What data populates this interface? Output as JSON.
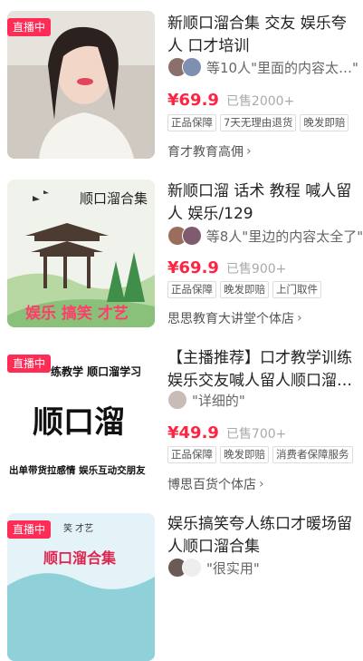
{
  "products": [
    {
      "badge": "直播中",
      "title": "新顺口溜合集  交友  娱乐夸人  口才培训",
      "buyers": "等10人\"里面的内容太…\"",
      "price": "¥69.9",
      "sold": "已售2000+",
      "tags": [
        "正品保障",
        "7天无理由退货",
        "晚发即赔"
      ],
      "shop": "育才教育高佣"
    },
    {
      "badge": "",
      "thumb_text": {
        "title": "顺口溜合集",
        "bottom": "娱乐  搞笑  才艺"
      },
      "title": "新顺口溜  话术  教程  喊人留人  娱乐/129",
      "buyers": "等8人\"里边的内容太全了\"",
      "price": "¥69.9",
      "sold": "已售900+",
      "tags": [
        "正品保障",
        "晚发即赔",
        "上门取件"
      ],
      "shop": "思思教育大讲堂个体店"
    },
    {
      "badge": "直播中",
      "thumb_text": {
        "top": "练教学  顺口溜学习",
        "main": "顺口溜",
        "bottom": "出单带货拉感情  娱乐互动交朋友"
      },
      "title": "【主播推荐】口才教学训练娱乐交友喊人留人顺口溜…",
      "buyers": "\"详细的\"",
      "price": "¥49.9",
      "sold": "已售700+",
      "tags": [
        "正品保障",
        "晚发即赔",
        "消费者保障服务"
      ],
      "shop": "博思百货个体店"
    },
    {
      "badge": "直播中",
      "thumb_text": {
        "top": "笑  才艺",
        "main": "顺口溜合集"
      },
      "title": "娱乐搞笑夸人练口才暖场留人顺口溜合集",
      "buyers": "\"很实用\""
    }
  ],
  "colors": {
    "price": "#ff2442",
    "badge": "#ff2d55"
  }
}
